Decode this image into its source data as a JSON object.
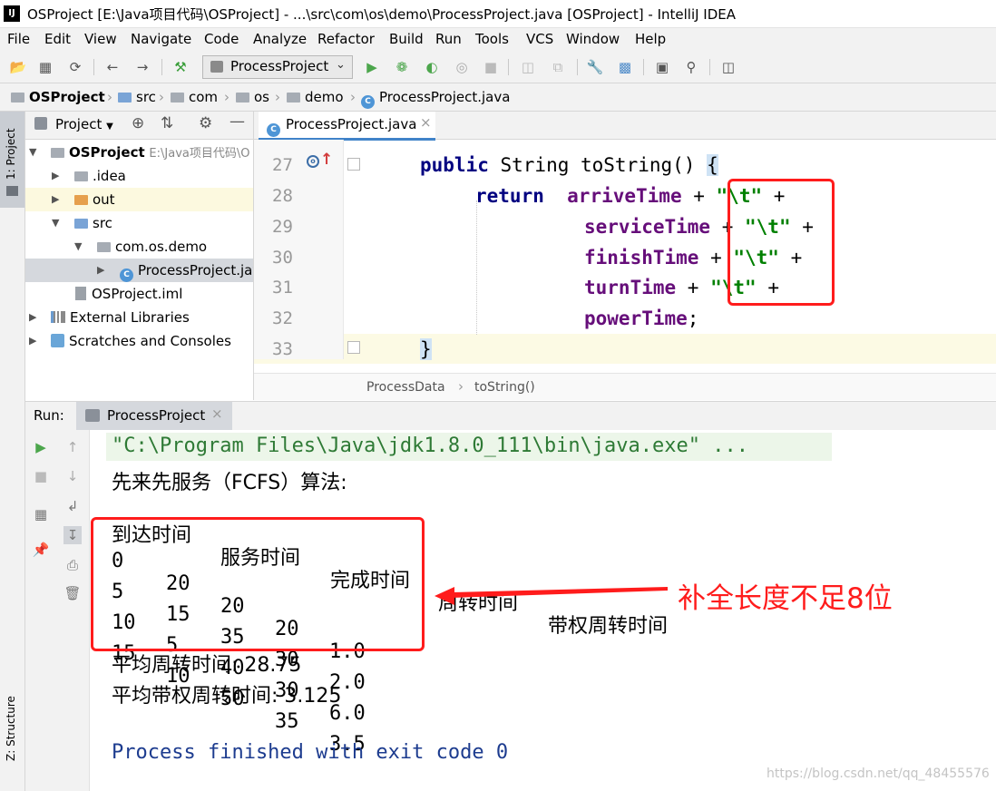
{
  "window": {
    "title": "OSProject [E:\\Java项目代码\\OSProject] - ...\\src\\com\\os\\demo\\ProcessProject.java [OSProject] - IntelliJ IDEA",
    "logo_text": "IJ"
  },
  "menu": [
    "File",
    "Edit",
    "View",
    "Navigate",
    "Code",
    "Analyze",
    "Refactor",
    "Build",
    "Run",
    "Tools",
    "VCS",
    "Window",
    "Help"
  ],
  "toolbar": {
    "run_config": "ProcessProject"
  },
  "breadcrumbs": [
    "OSProject",
    "src",
    "com",
    "os",
    "demo",
    "ProcessProject.java"
  ],
  "left_strip": {
    "project_tab": "1: Project",
    "structure_tab": "Z: Structure"
  },
  "project_panel": {
    "header": "Project",
    "tree": [
      {
        "label": "OSProject",
        "extra": "E:\\Java项目代码\\O"
      },
      {
        "label": ".idea"
      },
      {
        "label": "out"
      },
      {
        "label": "src"
      },
      {
        "label": "com.os.demo"
      },
      {
        "label": "ProcessProject.java"
      },
      {
        "label": "OSProject.iml"
      },
      {
        "label": "External Libraries"
      },
      {
        "label": "Scratches and Consoles"
      }
    ]
  },
  "editor": {
    "tab": "ProcessProject.java",
    "line_numbers": [
      "27",
      "28",
      "29",
      "30",
      "31",
      "32",
      "33"
    ],
    "lines": [
      {
        "kw": "public",
        "plain": " String toString() ",
        "brace": "{"
      },
      {
        "kw": "return",
        "field": "arriveTime",
        "op": " + ",
        "str": "\"\\t\"",
        "tail": " +"
      },
      {
        "field": "serviceTime",
        "op": " + ",
        "str": "\"\\t\"",
        "tail": " +"
      },
      {
        "field": "finishTime",
        "op": " + ",
        "str": "\"\\t\"",
        "tail": " +"
      },
      {
        "field": "turnTime",
        "op": " + ",
        "str": "\"\\t\"",
        "tail": " +"
      },
      {
        "field": "powerTime",
        "tail": ";"
      },
      {
        "brace": "}"
      }
    ],
    "crumbs": [
      "ProcessData",
      "toString()"
    ]
  },
  "run": {
    "label": "Run:",
    "tab": "ProcessProject",
    "console": {
      "cmd": "\"C:\\Program Files\\Java\\jdk1.8.0_111\\bin\\java.exe\" ...",
      "algo": "先来先服务（FCFS）算法:",
      "headers": [
        "到达时间",
        "服务时间",
        "完成时间",
        "周转时间",
        "带权周转时间"
      ],
      "rows": [
        [
          "0",
          "20",
          "20",
          "20",
          "1.0"
        ],
        [
          "5",
          "15",
          "35",
          "30",
          "2.0"
        ],
        [
          "10",
          "5",
          "40",
          "30",
          "6.0"
        ],
        [
          "15",
          "10",
          "50",
          "35",
          "3.5"
        ]
      ],
      "avg_turn": "平均周转时间: 28.75",
      "avg_weighted": "平均带权周转时间: 3.125",
      "finished": "Process finished with exit code 0"
    }
  },
  "annotation": {
    "text": "补全长度不足8位",
    "color": "#ff1c1c"
  },
  "watermark": "https://blog.csdn.net/qq_48455576"
}
